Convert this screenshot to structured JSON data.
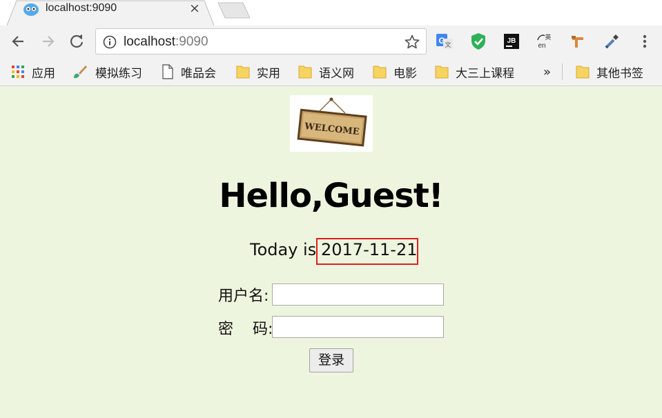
{
  "browser": {
    "tab": {
      "title": "localhost:9090",
      "close_glyph": "×"
    },
    "address_bar": {
      "host": "localhost",
      "port": ":9090"
    },
    "bookmarks": [
      {
        "label": "应用",
        "icon": "apps-grid-icon"
      },
      {
        "label": "模拟练习",
        "icon": "brush-icon"
      },
      {
        "label": "唯品会",
        "icon": "page-icon"
      },
      {
        "label": "实用",
        "icon": "folder-icon"
      },
      {
        "label": "语义网",
        "icon": "folder-icon"
      },
      {
        "label": "电影",
        "icon": "folder-icon"
      },
      {
        "label": "大三上课程",
        "icon": "folder-icon"
      },
      {
        "label": "其他书签",
        "icon": "folder-icon"
      }
    ],
    "overflow_glyph": "»",
    "extensions": [
      "google-translate-icon",
      "shield-check-icon",
      "jetbrains-icon",
      "translate-en-icon",
      "wrench-icon",
      "eyedropper-icon",
      "more-vert-icon"
    ]
  },
  "page": {
    "welcome_sign": "WELCOME",
    "greeting": "Hello,Guest!",
    "today_prefix": "Today is ",
    "date": "2017-11-21",
    "username_label": "用户名:",
    "password_label": "密    码:",
    "login_button": "登录",
    "colors": {
      "background": "#eef5de",
      "highlight_border": "#e01e1e"
    }
  }
}
